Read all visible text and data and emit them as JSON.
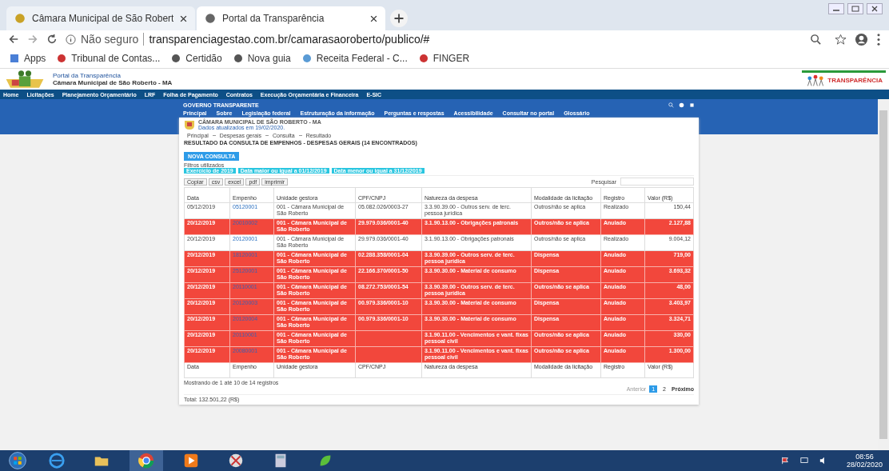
{
  "browser": {
    "tabs": [
      {
        "title": "Câmara Municipal de São Robert",
        "selected": false
      },
      {
        "title": "Portal da Transparência",
        "selected": true
      }
    ],
    "security": "Não seguro",
    "url": "transparenciagestao.com.br/camarasaoroberto/publico/#",
    "bookmarks": [
      "Apps",
      "Tribunal de Contas...",
      "Certidão",
      "Nova guia",
      "Receita Federal - C...",
      "FINGER"
    ]
  },
  "site": {
    "portal": "Portal da Transparência",
    "org": "Câmara Municipal de São Roberto - MA",
    "logo_text": "TRANSPARÊNCIA",
    "menu": [
      "Home",
      "Licitações",
      "Planejamento Orçamentário",
      "LRF",
      "Folha de Pagamento",
      "Contratos",
      "Execução Orçamentária e Financeira",
      "E-SIC"
    ]
  },
  "portal": {
    "brand": "GOVERNO TRANSPARENTE",
    "nav": [
      "Principal",
      "Sobre",
      "Legislação federal",
      "Estruturação da informação",
      "Perguntas e respostas",
      "Acessibilidade",
      "Consultar no portal",
      "Glossário"
    ],
    "org": "CÂMARA MUNICIPAL DE SÃO ROBERTO - MA",
    "updated": "Dados atualizados em 19/02/2020.",
    "breadcrumb": [
      "Principal",
      "Despesas gerais",
      "Consulta",
      "Resultado"
    ],
    "heading": "RESULTADO DA CONSULTA DE EMPENHOS - DESPESAS GERAIS (14 ENCONTRADOS)",
    "new_query": "NOVA CONSULTA",
    "filters_label": "Filtros utilizados",
    "filters": [
      "Exercício de 2019",
      "Data maior ou igual a 01/12/2019",
      "Data menor ou igual a 31/12/2019"
    ],
    "export_buttons": [
      "Copiar",
      "csv",
      "excel",
      "pdf",
      "imprimir"
    ],
    "search_label": "Pesquisar",
    "columns": [
      "Data",
      "Empenho",
      "Unidade gestora",
      "CPF/CNPJ",
      "Natureza da despesa",
      "Modalidade da licitação",
      "Registro",
      "Valor (R$)"
    ],
    "footer_columns": [
      "Data",
      "Empenho",
      "Unidade gestora",
      "CPF/CNPJ",
      "Natureza da despesa",
      "Modalidade da licitação",
      "Registro",
      "Valor (R$)"
    ],
    "rows": [
      {
        "date": "05/12/2019",
        "commitment": "05120001",
        "unit": "001 - Câmara Municipal de São Roberto",
        "tax_id": "05.082.026/0003-27",
        "nature": "3.3.90.39.00 - Outros serv. de terc. pessoa jurídica",
        "modality": "Outros/não se aplica",
        "record": "Realizado",
        "value": "150,44",
        "annulled": false
      },
      {
        "date": "20/12/2019",
        "commitment": "20010002",
        "unit": "001 - Câmara Municipal de São Roberto",
        "tax_id": "29.979.036/0001-40",
        "nature": "3.1.90.13.00 - Obrigações patronais",
        "modality": "Outros/não se aplica",
        "record": "Anulado",
        "value": "2.127,88",
        "annulled": true
      },
      {
        "date": "20/12/2019",
        "commitment": "20120001",
        "unit": "001 - Câmara Municipal de São Roberto",
        "tax_id": "29.979.036/0001-40",
        "nature": "3.1.90.13.00 - Obrigações patronais",
        "modality": "Outros/não se aplica",
        "record": "Realizado",
        "value": "9.004,12",
        "annulled": false
      },
      {
        "date": "20/12/2019",
        "commitment": "18120001",
        "unit": "001 - Câmara Municipal de São Roberto",
        "tax_id": "02.288.358/0001-04",
        "nature": "3.3.90.39.00 - Outros serv. de terc. pessoa jurídica",
        "modality": "Dispensa",
        "record": "Anulado",
        "value": "719,00",
        "annulled": true
      },
      {
        "date": "20/12/2019",
        "commitment": "25120001",
        "unit": "001 - Câmara Municipal de São Roberto",
        "tax_id": "22.166.370/0001-50",
        "nature": "3.3.90.30.00 - Material de consumo",
        "modality": "Dispensa",
        "record": "Anulado",
        "value": "3.693,32",
        "annulled": true
      },
      {
        "date": "20/12/2019",
        "commitment": "20110001",
        "unit": "001 - Câmara Municipal de São Roberto",
        "tax_id": "08.272.753/0001-54",
        "nature": "3.3.90.39.00 - Outros serv. de terc. pessoa jurídica",
        "modality": "Outros/não se aplica",
        "record": "Anulado",
        "value": "48,00",
        "annulled": true
      },
      {
        "date": "20/12/2019",
        "commitment": "20120003",
        "unit": "001 - Câmara Municipal de São Roberto",
        "tax_id": "00.979.336/0001-10",
        "nature": "3.3.90.30.00 - Material de consumo",
        "modality": "Dispensa",
        "record": "Anulado",
        "value": "3.403,97",
        "annulled": true
      },
      {
        "date": "20/12/2019",
        "commitment": "20120004",
        "unit": "001 - Câmara Municipal de São Roberto",
        "tax_id": "00.979.336/0001-10",
        "nature": "3.3.90.30.00 - Material de consumo",
        "modality": "Dispensa",
        "record": "Anulado",
        "value": "3.324,71",
        "annulled": true
      },
      {
        "date": "20/12/2019",
        "commitment": "20110001",
        "unit": "001 - Câmara Municipal de São Roberto",
        "nature": "3.1.90.11.00 - Vencimentos e vant. fixas pessoal civil",
        "modality": "Outros/não se aplica",
        "record": "Anulado",
        "value": "330,00",
        "annulled": true
      },
      {
        "date": "20/12/2019",
        "commitment": "20080001",
        "unit": "001 - Câmara Municipal de São Roberto",
        "nature": "3.1.90.11.00 - Vencimentos e vant. fixas pessoal civil",
        "modality": "Outros/não se aplica",
        "record": "Anulado",
        "value": "1.300,00",
        "annulled": true
      }
    ],
    "info": "Mostrando de 1 até 10 de 14 registros",
    "pagination": {
      "previous": "Anterior",
      "pages": [
        {
          "label": "1",
          "selected": true
        },
        {
          "label": "2",
          "selected": false
        }
      ],
      "next": "Próximo"
    },
    "total": "Total: 132.501,22 (R$)"
  },
  "taskbar": {
    "time": "08:56",
    "date": "28/02/2020"
  }
}
